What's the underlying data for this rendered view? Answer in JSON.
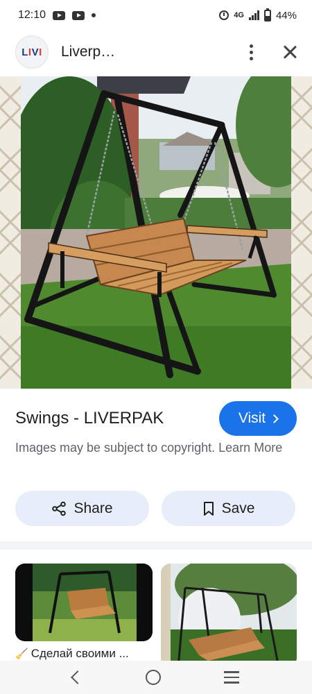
{
  "status_bar": {
    "time": "12:10",
    "network": "4G",
    "battery": "44%",
    "battery_level": 0.44
  },
  "header": {
    "logo_text": "LIVI",
    "title": "Liverp…"
  },
  "image": {
    "title": "Swings - LIVERPAK",
    "visit_label": "Visit",
    "copyright_text": "Images may be subject to copyright.",
    "learn_more_label": "Learn More"
  },
  "actions": {
    "share_label": "Share",
    "save_label": "Save"
  },
  "related": {
    "caption": "Сделай своими ..."
  },
  "icons": {
    "status": [
      "youtube-icon",
      "youtube-icon",
      "dot-icon",
      "alarm-icon",
      "signal-icon",
      "battery-icon"
    ],
    "header": [
      "kebab-icon",
      "close-icon"
    ],
    "lens": "lens-icon",
    "share": "share-icon",
    "save": "bookmark-icon",
    "caption": "broom-icon",
    "nav": [
      "back-icon",
      "home-icon",
      "recents-icon"
    ]
  },
  "colors": {
    "accent": "#1a73e8",
    "pill_bg": "#e8eef9"
  }
}
